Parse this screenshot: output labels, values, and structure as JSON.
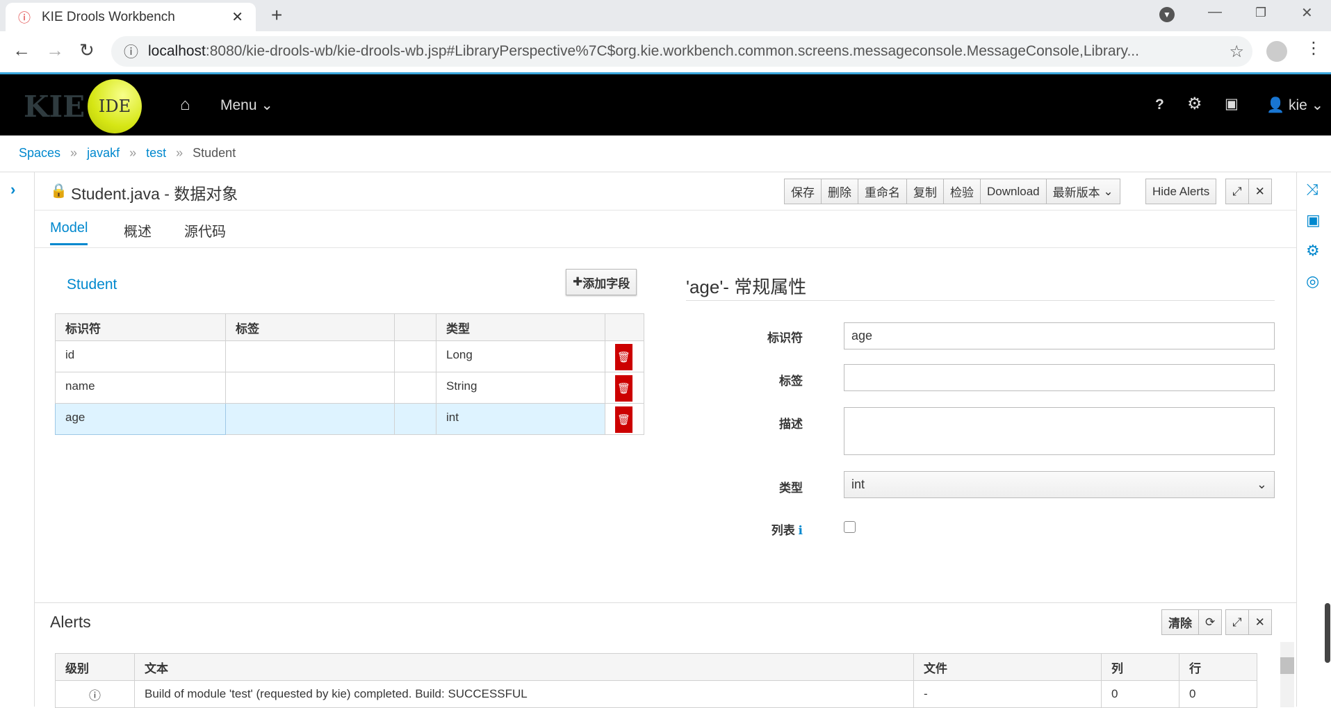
{
  "browser": {
    "tab_title": "KIE Drools Workbench",
    "url_host": "localhost",
    "url_rest": ":8080/kie-drools-wb/kie-drools-wb.jsp#LibraryPerspective%7C$org.kie.workbench.common.screens.messageconsole.MessageConsole,Library..."
  },
  "navbar": {
    "logo_text": "KIE",
    "logo_badge": "IDE",
    "menu": "Menu",
    "user": "kie"
  },
  "breadcrumb": [
    "Spaces",
    "javakf",
    "test",
    "Student"
  ],
  "editor": {
    "title": "Student.java - 数据对象",
    "buttons": [
      "保存",
      "删除",
      "重命名",
      "复制",
      "检验",
      "Download"
    ],
    "version": "最新版本",
    "hide_alerts": "Hide Alerts",
    "tabs": [
      "Model",
      "概述",
      "源代码"
    ],
    "active_tab": "Model"
  },
  "model": {
    "object_name": "Student",
    "add_field": "添加字段",
    "columns": [
      "标识符",
      "标签",
      "",
      "类型",
      ""
    ],
    "rows": [
      {
        "id": "id",
        "label": "",
        "type": "Long"
      },
      {
        "id": "name",
        "label": "",
        "type": "String"
      },
      {
        "id": "age",
        "label": "",
        "type": "int",
        "selected": true
      }
    ]
  },
  "properties": {
    "title": "'age'- 常规属性",
    "identifier_label": "标识符",
    "identifier_value": "age",
    "label_label": "标签",
    "label_value": "",
    "desc_label": "描述",
    "desc_value": "",
    "type_label": "类型",
    "type_value": "int",
    "list_label": "列表",
    "list_checked": false
  },
  "alerts": {
    "title": "Alerts",
    "clear": "清除",
    "columns": [
      "级别",
      "文本",
      "文件",
      "列",
      "行"
    ],
    "rows": [
      {
        "level": "info",
        "text": "Build of module 'test' (requested by kie) completed. Build: SUCCESSFUL",
        "file": "-",
        "col": "0",
        "row": "0"
      }
    ]
  },
  "colors": {
    "accent": "#0088ce",
    "danger": "#cc0000",
    "selected_row": "#def3ff",
    "navbar": "#000000"
  }
}
